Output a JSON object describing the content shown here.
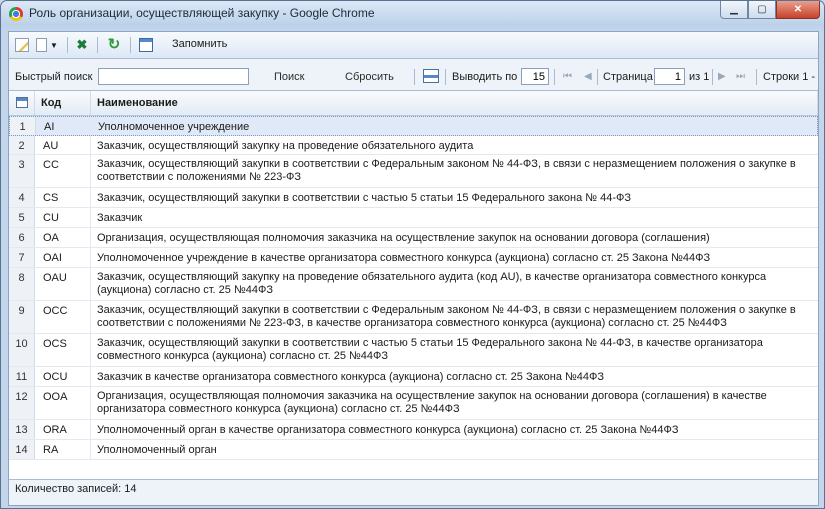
{
  "window": {
    "title": "Роль организации, осуществляющей закупку - Google Chrome"
  },
  "toolbar": {
    "remember_label": "Запомнить"
  },
  "search": {
    "label": "Быстрый поиск",
    "value": "",
    "search_button": "Поиск",
    "reset_button": "Сбросить",
    "page_size_label": "Выводить по",
    "page_size_value": "15",
    "page_label": "Страница",
    "page_value": "1",
    "page_of": "из 1",
    "rows_label": "Строки 1 -"
  },
  "grid": {
    "columns": {
      "num": "",
      "code": "Код",
      "name": "Наименование"
    },
    "rows": [
      {
        "num": "1",
        "code": "AI",
        "name": "Уполномоченное учреждение"
      },
      {
        "num": "2",
        "code": "AU",
        "name": "Заказчик, осуществляющий закупку на проведение обязательного аудита"
      },
      {
        "num": "3",
        "code": "CC",
        "name": "Заказчик, осуществляющий закупки в соответствии с Федеральным законом № 44-ФЗ, в связи с неразмещением положения о закупке в соответствии с положениями № 223-ФЗ"
      },
      {
        "num": "4",
        "code": "CS",
        "name": "Заказчик, осуществляющий закупки в соответствии с частью 5 статьи 15 Федерального закона № 44-ФЗ"
      },
      {
        "num": "5",
        "code": "CU",
        "name": "Заказчик"
      },
      {
        "num": "6",
        "code": "OA",
        "name": "Организация, осуществляющая полномочия заказчика на осуществление закупок на основании договора (соглашения)"
      },
      {
        "num": "7",
        "code": "OAI",
        "name": "Уполномоченное учреждение в качестве организатора совместного конкурса (аукциона) согласно ст. 25 Закона №44ФЗ"
      },
      {
        "num": "8",
        "code": "OAU",
        "name": "Заказчик, осуществляющий закупку на проведение обязательного аудита (код AU), в качестве организатора совместного конкурса (аукциона) согласно ст. 25 №44ФЗ"
      },
      {
        "num": "9",
        "code": "OCC",
        "name": "Заказчик, осуществляющий закупки в соответствии с Федеральным законом № 44-ФЗ, в связи с неразмещением положения о закупке в соответствии с положениями № 223-ФЗ, в качестве организатора совместного конкурса (аукциона) согласно ст. 25 №44ФЗ"
      },
      {
        "num": "10",
        "code": "OCS",
        "name": "Заказчик, осуществляющий закупки в соответствии с частью 5 статьи 15 Федерального закона № 44-ФЗ, в качестве организатора совместного конкурса (аукциона) согласно ст. 25 №44ФЗ"
      },
      {
        "num": "11",
        "code": "OCU",
        "name": "Заказчик в качестве организатора совместного конкурса (аукциона) согласно ст. 25 Закона №44ФЗ"
      },
      {
        "num": "12",
        "code": "OOA",
        "name": "Организация, осуществляющая полномочия заказчика на осуществление закупок на основании договора (соглашения) в качестве организатора совместного конкурса (аукциона) согласно ст. 25 №44ФЗ"
      },
      {
        "num": "13",
        "code": "ORA",
        "name": "Уполномоченный орган в качестве организатора совместного конкурса (аукциона) согласно ст. 25 Закона №44ФЗ"
      },
      {
        "num": "14",
        "code": "RA",
        "name": "Уполномоченный орган"
      }
    ]
  },
  "footer": {
    "record_count": "Количество записей: 14"
  }
}
